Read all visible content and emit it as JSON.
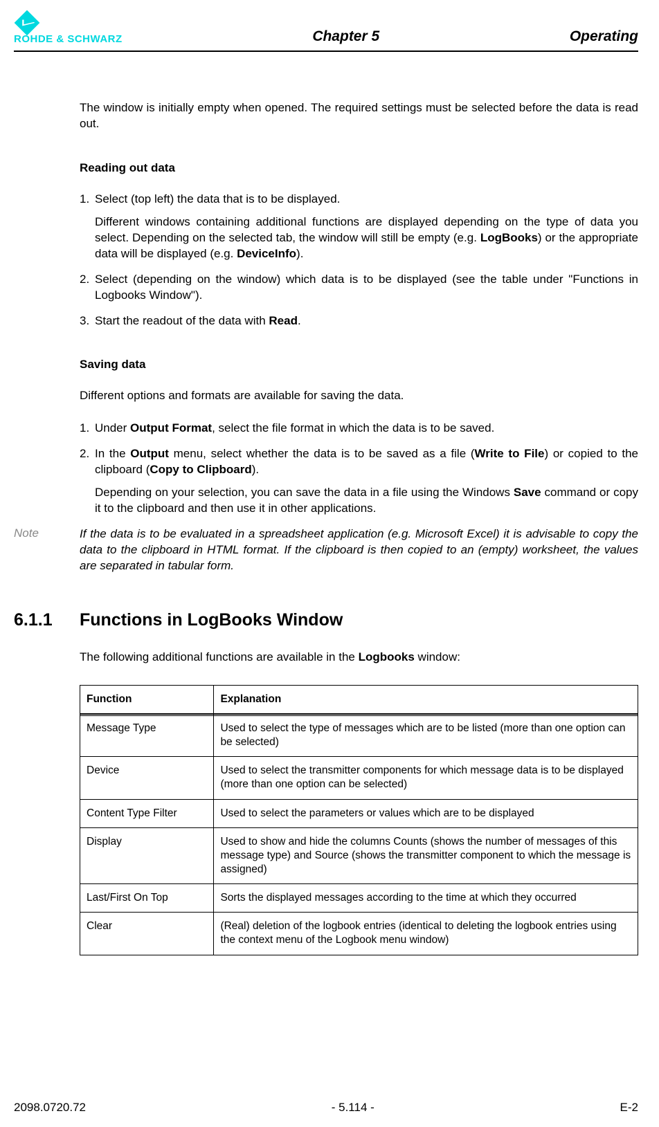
{
  "header": {
    "brand": "ROHDE & SCHWARZ",
    "chapter": "Chapter 5",
    "title": "Operating"
  },
  "intro": "The window is initially empty when opened. The required settings must be selected before the data is read out.",
  "reading": {
    "heading": "Reading out data",
    "s1": "Select (top left) the data that is to be displayed.",
    "s1b_a": "Different windows containing additional functions are displayed depending on the type of data you select. Depending on the selected tab, the window will still be empty (e.g. ",
    "s1b_log": "LogBooks",
    "s1b_b": ") or the appropriate data will be displayed (e.g. ",
    "s1b_dev": "DeviceInfo",
    "s1b_c": ").",
    "s2": "Select (depending on the window) which data is to be displayed (see the table under \"Functions in Logbooks Window\").",
    "s3_a": "Start the readout of the data with ",
    "s3_read": "Read",
    "s3_b": "."
  },
  "saving": {
    "heading": "Saving data",
    "intro": "Different options and formats are available for saving the data.",
    "s1_a": "Under ",
    "s1_of": "Output Format",
    "s1_b": ", select the file format in which the data is to be saved.",
    "s2_a": "In the ",
    "s2_out": "Output",
    "s2_b": " menu, select whether the data is to be saved as a file (",
    "s2_wtf": "Write to File",
    "s2_c": ") or copied to the clipboard (",
    "s2_ctc": "Copy to Clipboard",
    "s2_d": ").",
    "s2e_a": "Depending on your selection, you can save the data in a file using the Windows ",
    "s2e_save": "Save",
    "s2e_b": " command or copy it to the clipboard and then use it in other applications."
  },
  "note": {
    "label": "Note",
    "text": "If the data is to be evaluated in a spreadsheet application (e.g. Microsoft Excel) it is advisable to copy the data to the clipboard in HTML format. If the clipboard is then copied to an (empty) worksheet, the values are separated in tabular form."
  },
  "section611": {
    "num": "6.1.1",
    "title": "Functions in LogBooks Window",
    "intro_a": "The following additional functions are available in the ",
    "intro_b": "Logbooks",
    "intro_c": " window:"
  },
  "table": {
    "h1": "Function",
    "h2": "Explanation",
    "rows": [
      {
        "f": "Message Type",
        "e": "Used to select the type of messages which are to be listed (more than one option can be selected)"
      },
      {
        "f": "Device",
        "e": "Used to select the transmitter components for which message data is to be displayed (more than one option can be selected)"
      },
      {
        "f": "Content Type Filter",
        "e": "Used to select the parameters or values which are to be displayed"
      },
      {
        "f": "Display",
        "e": "Used to show and hide the columns Counts (shows the number of messages of this message type) and Source (shows the transmitter component to which the message is assigned)"
      },
      {
        "f": "Last/First On Top",
        "e": "Sorts the displayed messages according to the time at which they occurred"
      },
      {
        "f": "Clear",
        "e": "(Real) deletion of the logbook entries (identical to deleting the logbook entries using the context menu of the Logbook menu window)"
      }
    ]
  },
  "footer": {
    "left": "2098.0720.72",
    "center": "- 5.114 -",
    "right": "E-2"
  }
}
